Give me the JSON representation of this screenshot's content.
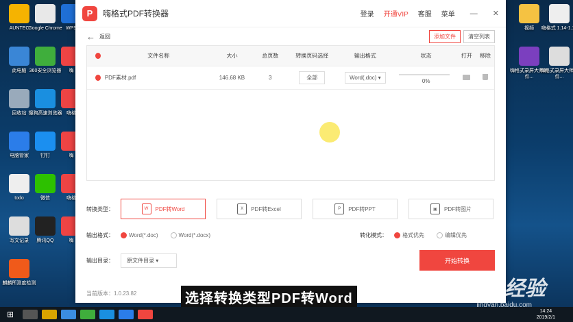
{
  "desktop": {
    "left_icons": [
      {
        "label": "AUNTEC",
        "color": "#f5b301"
      },
      {
        "label": "Google Chrome",
        "color": "#e8e8e8"
      },
      {
        "label": "WPS",
        "color": "#1f6fd6"
      },
      {
        "label": "此电脑",
        "color": "#3a86d6"
      },
      {
        "label": "360安全浏览器",
        "color": "#3fae3c"
      },
      {
        "label": "嗨",
        "color": "#e44"
      },
      {
        "label": "回收站",
        "color": "#9ab"
      },
      {
        "label": "搜狗高速浏览器",
        "color": "#1a8fe0"
      },
      {
        "label": "嗨格",
        "color": "#e44"
      },
      {
        "label": "电脑管家",
        "color": "#2b7de9"
      },
      {
        "label": "钉钉",
        "color": "#1b8ff0"
      },
      {
        "label": "嗨",
        "color": "#e44"
      },
      {
        "label": "todo",
        "color": "#eee"
      },
      {
        "label": "微信",
        "color": "#2dc100"
      },
      {
        "label": "嗨格",
        "color": "#e44"
      },
      {
        "label": "写文记录",
        "color": "#ddd"
      },
      {
        "label": "腾讯QQ",
        "color": "#222"
      },
      {
        "label": "嗨",
        "color": "#e44"
      },
      {
        "label": "麒麟所测度检测",
        "color": "#f05a1a"
      }
    ],
    "right_icons": [
      {
        "label": "视频",
        "color": "#f5c242"
      },
      {
        "label": "嗨格式\n1.14-1.18",
        "color": "#eee"
      },
      {
        "label": "嗨格式录屏大师软件...",
        "color": "#7b3fbf"
      },
      {
        "label": "嗨格式录屏大师软件...",
        "color": "#ddd"
      }
    ]
  },
  "window": {
    "title": "嗨格式PDF转换器",
    "nav": {
      "login": "登录",
      "vip": "开通VIP",
      "service": "客服",
      "menu": "菜单"
    },
    "toolbar": {
      "back": "返回",
      "add": "添加文件",
      "clear": "清空列表"
    },
    "table": {
      "headers": {
        "name": "文件名称",
        "size": "大小",
        "pages": "总页数",
        "range": "转换页码选择",
        "format": "输出格式",
        "status": "状态",
        "open": "打开",
        "remove": "移除"
      },
      "rows": [
        {
          "name": "PDF素材.pdf",
          "size": "146.68 KB",
          "pages": "3",
          "range": "全部",
          "format": "Word(.doc)",
          "progress": 0,
          "progress_label": "0%"
        }
      ]
    },
    "convert_type": {
      "label": "转换类型：",
      "options": [
        "PDF转Word",
        "PDF转Excel",
        "PDF转PPT",
        "PDF转图片"
      ],
      "active": 0
    },
    "output_format": {
      "label": "输出格式：",
      "options": [
        "Word(*.doc)",
        "Word(*.docx)"
      ],
      "selected": 0
    },
    "mode": {
      "label": "转化模式：",
      "options": [
        "格式优先",
        "编辑优先"
      ],
      "selected": 0
    },
    "output_dir": {
      "label": "输出目录：",
      "value": "原文件目录"
    },
    "start": "开始转换",
    "version": "当前版本：1.0.23.82"
  },
  "caption": "选择转换类型PDF转Word",
  "watermark": {
    "main": "Baidu经验",
    "sub": "jingyan.baidu.com"
  },
  "taskbar": {
    "time": "14:24",
    "date": "2019/2/1"
  },
  "colors": {
    "accent": "#f0463f"
  }
}
